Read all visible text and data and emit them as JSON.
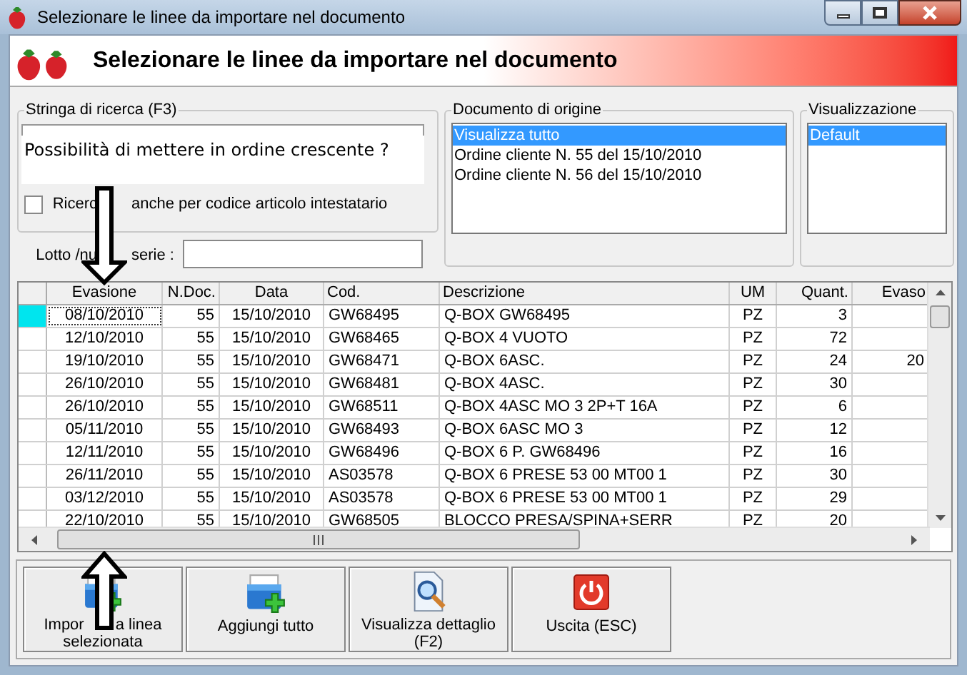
{
  "window": {
    "title": "Selezionare le linee da importare nel documento"
  },
  "header": {
    "title": "Selezionare le linee da importare nel documento"
  },
  "search_group": {
    "title": "Stringa di ricerca (F3)",
    "annotation": "Possibilità di mettere in ordine crescente ?",
    "checkbox": {
      "label_parts": [
        "Ricerc",
        "anche per codice articolo intestatario"
      ],
      "checked": false
    }
  },
  "origin_group": {
    "title": "Documento di origine",
    "items": [
      {
        "label": "Visualizza tutto",
        "selected": true
      },
      {
        "label": "Ordine cliente N. 55 del 15/10/2010",
        "selected": false
      },
      {
        "label": "Ordine cliente N. 56 del 15/10/2010",
        "selected": false
      }
    ]
  },
  "view_group": {
    "title": "Visualizzazione",
    "items": [
      {
        "label": "Default",
        "selected": true
      }
    ]
  },
  "lot_field": {
    "label_parts": [
      "Lotto /nu",
      "serie :"
    ]
  },
  "table": {
    "columns": [
      "Evasione",
      "N.Doc.",
      "Data",
      "Cod.",
      "Descrizione",
      "UM",
      "Quant.",
      "Evaso"
    ],
    "rows": [
      {
        "selected": true,
        "cells": [
          "08/10/2010",
          "55",
          "15/10/2010",
          "GW68495",
          "Q-BOX GW68495",
          "PZ",
          "3"
        ]
      },
      {
        "selected": false,
        "cells": [
          "12/10/2010",
          "55",
          "15/10/2010",
          "GW68465",
          "Q-BOX 4 VUOTO",
          "PZ",
          "72"
        ]
      },
      {
        "selected": false,
        "cells": [
          "19/10/2010",
          "55",
          "15/10/2010",
          "GW68471",
          "Q-BOX 6ASC.",
          "PZ",
          "24",
          "20"
        ]
      },
      {
        "selected": false,
        "cells": [
          "26/10/2010",
          "55",
          "15/10/2010",
          "GW68481",
          "Q-BOX 4ASC.",
          "PZ",
          "30"
        ]
      },
      {
        "selected": false,
        "cells": [
          "26/10/2010",
          "55",
          "15/10/2010",
          "GW68511",
          "Q-BOX 4ASC MO 3 2P+T 16A",
          "PZ",
          "6"
        ]
      },
      {
        "selected": false,
        "cells": [
          "05/11/2010",
          "55",
          "15/10/2010",
          "GW68493",
          "Q-BOX 6ASC MO 3",
          "PZ",
          "12"
        ]
      },
      {
        "selected": false,
        "cells": [
          "12/11/2010",
          "55",
          "15/10/2010",
          "GW68496",
          "Q-BOX 6 P. GW68496",
          "PZ",
          "16"
        ]
      },
      {
        "selected": false,
        "cells": [
          "26/11/2010",
          "55",
          "15/10/2010",
          "AS03578",
          "Q-BOX 6 PRESE 53 00 MT00 1",
          "PZ",
          "30"
        ]
      },
      {
        "selected": false,
        "cells": [
          "03/12/2010",
          "55",
          "15/10/2010",
          "AS03578",
          "Q-BOX 6 PRESE 53 00 MT00 1",
          "PZ",
          "29"
        ]
      },
      {
        "selected": false,
        "cells": [
          "22/10/2010",
          "55",
          "15/10/2010",
          "GW68505",
          "BLOCCO PRESA/SPINA+SERR",
          "PZ",
          "20"
        ]
      }
    ]
  },
  "buttons": [
    {
      "kind": "import",
      "label_lines": [
        "Impor a linea",
        "selezionata"
      ]
    },
    {
      "kind": "add_all",
      "label_lines": [
        "Aggiungi tutto"
      ]
    },
    {
      "kind": "detail",
      "label_lines": [
        "Visualizza dettaglio",
        "(F2)"
      ]
    },
    {
      "kind": "exit",
      "label_lines": [
        "Uscita (ESC)"
      ]
    }
  ]
}
